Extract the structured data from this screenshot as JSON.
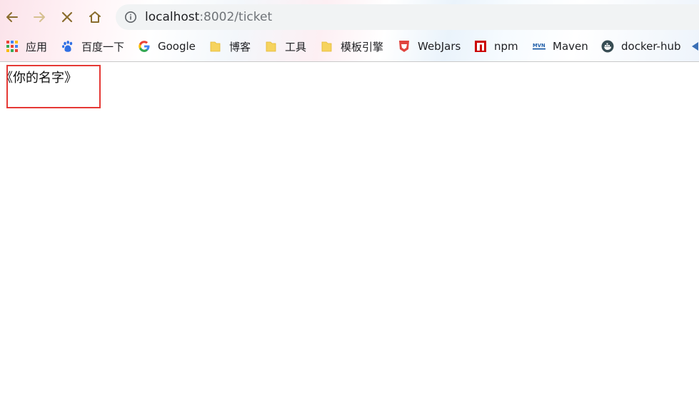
{
  "browser": {
    "url_host": "localhost",
    "url_rest": ":8002/ticket",
    "bookmarks": [
      {
        "label": "应用",
        "icon": "apps-grid-icon"
      },
      {
        "label": "百度一下",
        "icon": "baidu-paw-icon"
      },
      {
        "label": "Google",
        "icon": "google-g-icon"
      },
      {
        "label": "博客",
        "icon": "folder-icon"
      },
      {
        "label": "工具",
        "icon": "folder-icon"
      },
      {
        "label": "模板引擎",
        "icon": "folder-icon"
      },
      {
        "label": "WebJars",
        "icon": "webjars-icon"
      },
      {
        "label": "npm",
        "icon": "npm-icon"
      },
      {
        "label": "Maven",
        "icon": "maven-icon"
      },
      {
        "label": "docker-hub",
        "icon": "docker-icon"
      }
    ]
  },
  "page": {
    "text": "《你的名字》"
  },
  "colors": {
    "highlight": "#e53935",
    "nav_icon": "#8a6d2f",
    "folder": "#f6d35e"
  }
}
